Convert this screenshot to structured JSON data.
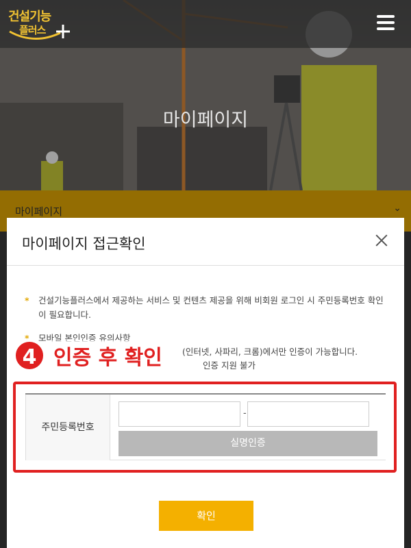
{
  "header": {
    "logo_line1": "건설기능",
    "logo_line2": "플러스"
  },
  "hero": {
    "title": "마이페이지"
  },
  "accordion": {
    "label": "마이페이지",
    "chevron": "⌄"
  },
  "modal": {
    "title": "마이페이지 접근확인",
    "notice1": "건설기능플러스에서 제공하는 서비스 및 컨텐츠 제공을 위해 비회원 로그인 시 주민등록번호 확인이 필요합니다.",
    "notice2_line1": "모바일 본인인증 유의사항",
    "notice2_line2": "(인터넷, 사파리, 크롬)에서만 인증이 가능합니다.",
    "notice2_line3": "인증 지원 불가",
    "step_number": "4",
    "step_text": "인증 후 확인",
    "field_label": "주민등록번호",
    "dash": "-",
    "verify_label": "실명인증",
    "confirm_label": "확인"
  }
}
